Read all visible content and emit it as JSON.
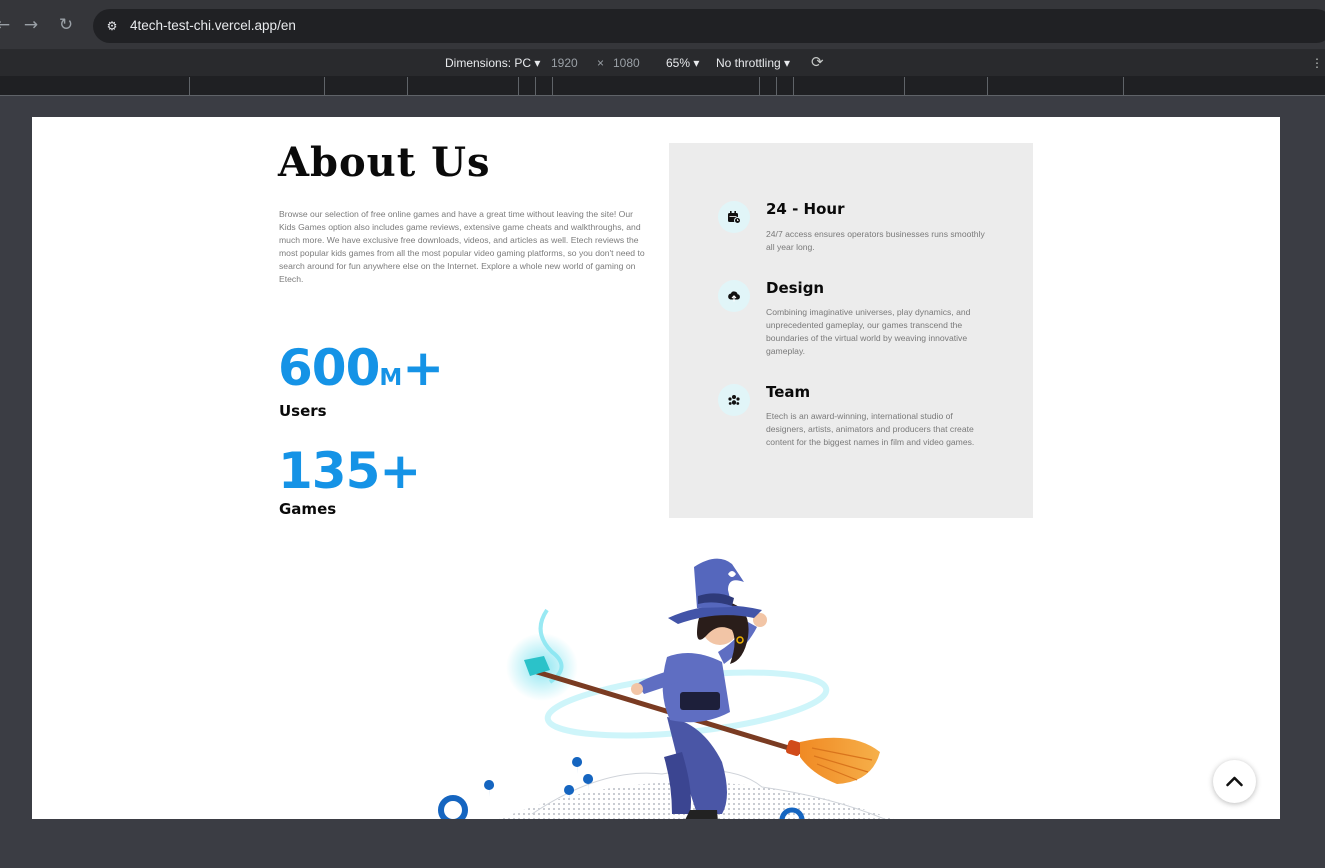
{
  "browser": {
    "url": "4tech-test-chi.vercel.app/en",
    "back_icon": "arrow-left-icon",
    "forward_icon": "arrow-right-icon",
    "reload_icon": "reload-icon",
    "site_info_icon": "tune-icon"
  },
  "devtools": {
    "dimensions_label": "Dimensions: PC",
    "width": "1920",
    "times": "×",
    "height": "1080",
    "zoom": "65%",
    "throttling": "No throttling",
    "rotate_icon": "rotate-icon",
    "more_icon": "kebab-icon"
  },
  "about": {
    "title": "About Us",
    "description": "Browse our selection of free online games and have a great time without leaving the site! Our Kids Games option also includes game reviews, extensive game cheats and walkthroughs, and much more. We have exclusive free downloads, videos, and articles as well. Etech reviews the most popular kids games from all the most popular video gaming platforms, so you don't need to search around for fun anywhere else on the Internet. Explore a whole new world of gaming on Etech."
  },
  "stats": [
    {
      "number": "600",
      "unit": "M",
      "suffix": "+",
      "label": "Users"
    },
    {
      "number": "135",
      "unit": "",
      "suffix": "+",
      "label": "Games"
    }
  ],
  "features": [
    {
      "title": "24 - Hour",
      "icon": "calendar-clock-icon",
      "description": "24/7 access ensures operators businesses runs smoothly all year long."
    },
    {
      "title": "Design",
      "icon": "cloud-upload-icon",
      "description": "Combining imaginative universes, play dynamics, and unprecedented gameplay, our games transcend the boundaries of the virtual world by weaving innovative gameplay."
    },
    {
      "title": "Team",
      "icon": "team-icon",
      "description": "Etech is an award-winning, international studio of designers, artists, animators and producers that create content for the biggest names in film and video games."
    }
  ],
  "scroll_top_icon": "chevron-up-icon",
  "colors": {
    "accent": "#1593e6",
    "panel": "#ececec",
    "icon_bg": "#e1f5f8",
    "witch_purple": "#4a56a6",
    "map_pin": "#1565c0"
  }
}
